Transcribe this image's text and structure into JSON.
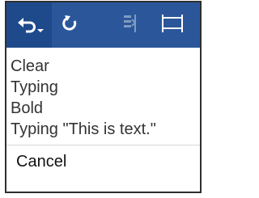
{
  "toolbar": {
    "buttons": [
      {
        "icon": "undo-icon",
        "has_dropdown": true
      },
      {
        "icon": "redo-icon"
      },
      {
        "icon": "repeat-icon",
        "disabled": true
      },
      {
        "icon": "ruler-icon"
      }
    ]
  },
  "undo_menu": {
    "items": [
      "Clear",
      "Typing",
      "Bold",
      "Typing \"This is text.\""
    ],
    "cancel_label": "Cancel"
  },
  "colors": {
    "toolbar_bg": "#2b579a",
    "selected_bg": "#1e4a8c",
    "icon": "#ffffff",
    "disabled_icon": "#7f9ac4"
  }
}
